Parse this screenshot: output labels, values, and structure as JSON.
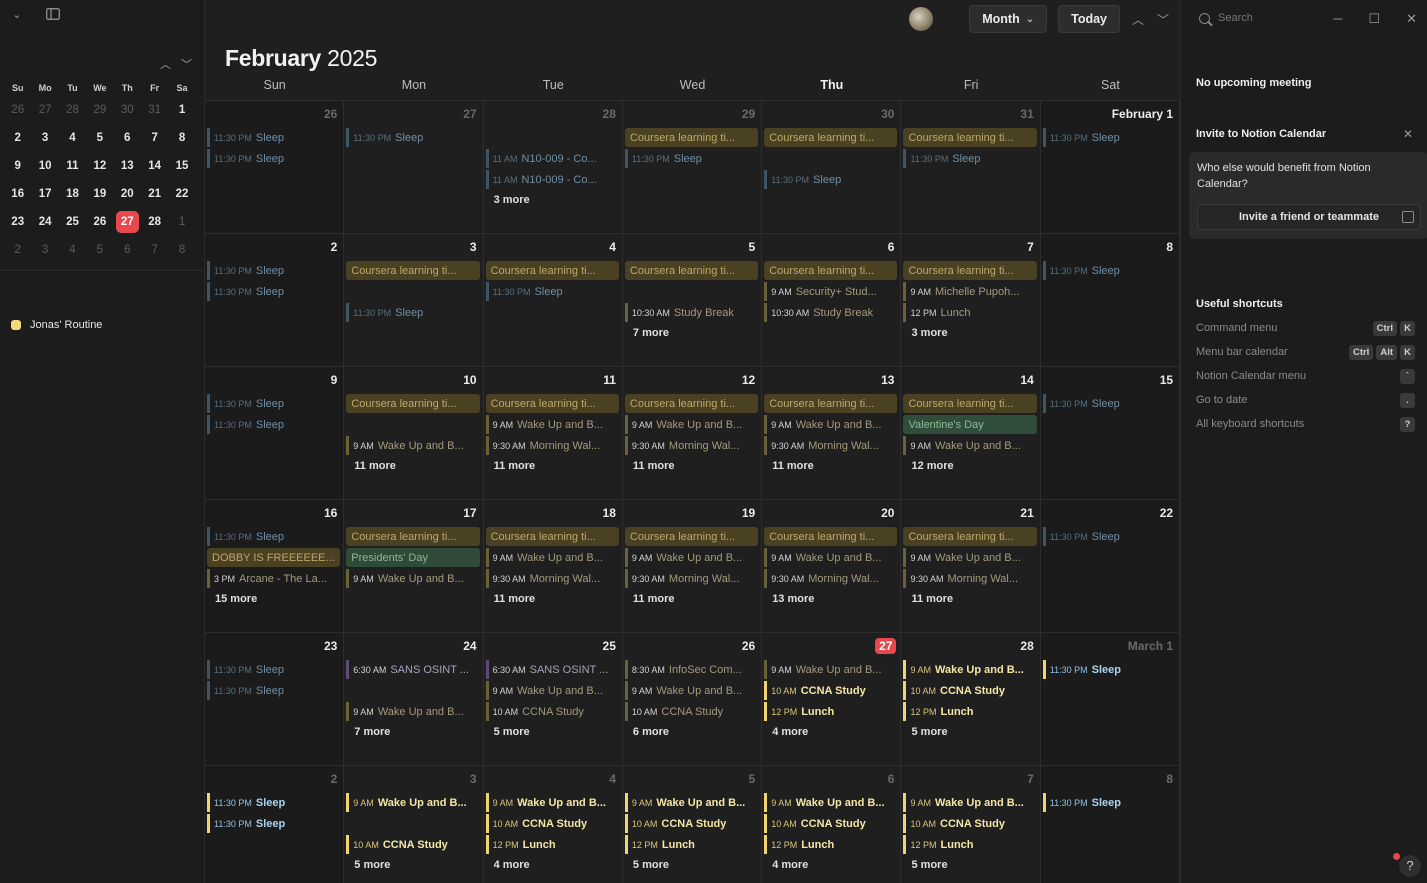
{
  "sidebar": {
    "mini_days_header": [
      "Su",
      "Mo",
      "Tu",
      "We",
      "Th",
      "Fr",
      "Sa"
    ],
    "mini_weeks": [
      [
        {
          "d": "26",
          "dim": true
        },
        {
          "d": "27",
          "dim": true
        },
        {
          "d": "28",
          "dim": true
        },
        {
          "d": "29",
          "dim": true
        },
        {
          "d": "30",
          "dim": true
        },
        {
          "d": "31",
          "dim": true
        },
        {
          "d": "1"
        }
      ],
      [
        {
          "d": "2"
        },
        {
          "d": "3"
        },
        {
          "d": "4"
        },
        {
          "d": "5"
        },
        {
          "d": "6"
        },
        {
          "d": "7"
        },
        {
          "d": "8"
        }
      ],
      [
        {
          "d": "9"
        },
        {
          "d": "10"
        },
        {
          "d": "11"
        },
        {
          "d": "12"
        },
        {
          "d": "13"
        },
        {
          "d": "14"
        },
        {
          "d": "15"
        }
      ],
      [
        {
          "d": "16"
        },
        {
          "d": "17"
        },
        {
          "d": "18"
        },
        {
          "d": "19"
        },
        {
          "d": "20"
        },
        {
          "d": "21"
        },
        {
          "d": "22"
        }
      ],
      [
        {
          "d": "23"
        },
        {
          "d": "24"
        },
        {
          "d": "25"
        },
        {
          "d": "26"
        },
        {
          "d": "27",
          "today": true
        },
        {
          "d": "28"
        },
        {
          "d": "1",
          "dim": true
        }
      ],
      [
        {
          "d": "2",
          "dim": true
        },
        {
          "d": "3",
          "dim": true
        },
        {
          "d": "4",
          "dim": true
        },
        {
          "d": "5",
          "dim": true
        },
        {
          "d": "6",
          "dim": true
        },
        {
          "d": "7",
          "dim": true
        },
        {
          "d": "8",
          "dim": true
        }
      ]
    ],
    "calendar_name": "Jonas' Routine",
    "calendar_color": "#f3d97a"
  },
  "toolbar": {
    "view_label": "Month",
    "today_label": "Today"
  },
  "header": {
    "month": "February",
    "year": "2025",
    "weekdays": [
      "Sun",
      "Mon",
      "Tue",
      "Wed",
      "Thu",
      "Fri",
      "Sat"
    ],
    "current_weekday_index": 4
  },
  "weeks": [
    [
      {
        "num": "26",
        "dim": true,
        "events": [
          {
            "s": "line past-blue",
            "t": "11:30 PM",
            "n": "Sleep"
          },
          {
            "s": "line past-blue",
            "t": "11:30 PM",
            "n": "Sleep"
          }
        ]
      },
      {
        "num": "27",
        "dim": true,
        "events": [
          {
            "s": "line past-blue",
            "t": "11:30 PM",
            "n": "Sleep"
          }
        ]
      },
      {
        "num": "28",
        "dim": true,
        "events": [
          {
            "s": "blank"
          },
          {
            "s": "line past-blue",
            "t": "11 AM",
            "n": "N10-009 - Co..."
          },
          {
            "s": "line past-blue",
            "t": "11 AM",
            "n": "N10-009 - Co..."
          }
        ],
        "more": "3 more"
      },
      {
        "num": "29",
        "dim": true,
        "events": [
          {
            "s": "block-yel",
            "n": "Coursera learning ti..."
          },
          {
            "s": "line past-blue",
            "t": "11:30 PM",
            "n": "Sleep"
          }
        ]
      },
      {
        "num": "30",
        "dim": true,
        "events": [
          {
            "s": "block-yel",
            "n": "Coursera learning ti..."
          },
          {
            "s": "blank"
          },
          {
            "s": "line past-blue",
            "t": "11:30 PM",
            "n": "Sleep"
          }
        ]
      },
      {
        "num": "31",
        "dim": true,
        "events": [
          {
            "s": "block-yel",
            "n": "Coursera learning ti..."
          },
          {
            "s": "line past-blue",
            "t": "11:30 PM",
            "n": "Sleep"
          }
        ]
      },
      {
        "num": "February 1",
        "mlabel": true,
        "events": [
          {
            "s": "line past-blue",
            "t": "11:30 PM",
            "n": "Sleep"
          }
        ]
      }
    ],
    [
      {
        "num": "2",
        "events": [
          {
            "s": "line past-blue",
            "t": "11:30 PM",
            "n": "Sleep"
          },
          {
            "s": "line past-blue",
            "t": "11:30 PM",
            "n": "Sleep"
          }
        ]
      },
      {
        "num": "3",
        "events": [
          {
            "s": "block-yel",
            "n": "Coursera learning ti..."
          },
          {
            "s": "blank"
          },
          {
            "s": "line past-blue",
            "t": "11:30 PM",
            "n": "Sleep"
          }
        ]
      },
      {
        "num": "4",
        "events": [
          {
            "s": "block-yel",
            "n": "Coursera learning ti..."
          },
          {
            "s": "line past-blue",
            "t": "11:30 PM",
            "n": "Sleep"
          }
        ]
      },
      {
        "num": "5",
        "events": [
          {
            "s": "block-yel",
            "n": "Coursera learning ti..."
          },
          {
            "s": "blank"
          },
          {
            "s": "line past-yel",
            "t": "10:30 AM",
            "n": "Study Break"
          }
        ],
        "more": "7 more"
      },
      {
        "num": "6",
        "events": [
          {
            "s": "block-yel",
            "n": "Coursera learning ti..."
          },
          {
            "s": "line past-yel",
            "t": "9 AM",
            "n": "Security+ Stud..."
          },
          {
            "s": "line past-yel",
            "t": "10:30 AM",
            "n": "Study Break"
          }
        ]
      },
      {
        "num": "7",
        "events": [
          {
            "s": "block-yel",
            "n": "Coursera learning ti..."
          },
          {
            "s": "line past-yel",
            "t": "9 AM",
            "n": "Michelle Pupoh..."
          },
          {
            "s": "line past-yel",
            "t": "12 PM",
            "n": "Lunch"
          }
        ],
        "more": "3 more"
      },
      {
        "num": "8",
        "events": [
          {
            "s": "line past-blue",
            "t": "11:30 PM",
            "n": "Sleep"
          }
        ]
      }
    ],
    [
      {
        "num": "9",
        "events": [
          {
            "s": "line past-blue",
            "t": "11:30 PM",
            "n": "Sleep"
          },
          {
            "s": "line past-blue",
            "t": "11:30 PM",
            "n": "Sleep"
          }
        ]
      },
      {
        "num": "10",
        "events": [
          {
            "s": "block-yel",
            "n": "Coursera learning ti..."
          },
          {
            "s": "blank"
          },
          {
            "s": "line past-yel",
            "t": "9 AM",
            "n": "Wake Up and B..."
          }
        ],
        "more": "11 more"
      },
      {
        "num": "11",
        "events": [
          {
            "s": "block-yel",
            "n": "Coursera learning ti..."
          },
          {
            "s": "line past-yel",
            "t": "9 AM",
            "n": "Wake Up and B..."
          },
          {
            "s": "line past-yel",
            "t": "9:30 AM",
            "n": "Morning Wal..."
          }
        ],
        "more": "11 more"
      },
      {
        "num": "12",
        "events": [
          {
            "s": "block-yel",
            "n": "Coursera learning ti..."
          },
          {
            "s": "line past-yel",
            "t": "9 AM",
            "n": "Wake Up and B..."
          },
          {
            "s": "line past-yel",
            "t": "9:30 AM",
            "n": "Morning Wal..."
          }
        ],
        "more": "11 more"
      },
      {
        "num": "13",
        "events": [
          {
            "s": "block-yel",
            "n": "Coursera learning ti..."
          },
          {
            "s": "line past-yel",
            "t": "9 AM",
            "n": "Wake Up and B..."
          },
          {
            "s": "line past-yel",
            "t": "9:30 AM",
            "n": "Morning Wal..."
          }
        ],
        "more": "11 more"
      },
      {
        "num": "14",
        "events": [
          {
            "s": "block-yel",
            "n": "Coursera learning ti..."
          },
          {
            "s": "block-green",
            "n": "Valentine's Day"
          },
          {
            "s": "line past-yel",
            "t": "9 AM",
            "n": "Wake Up and B..."
          }
        ],
        "more": "12 more"
      },
      {
        "num": "15",
        "events": [
          {
            "s": "line past-blue",
            "t": "11:30 PM",
            "n": "Sleep"
          }
        ]
      }
    ],
    [
      {
        "num": "16",
        "events": [
          {
            "s": "line past-blue",
            "t": "11:30 PM",
            "n": "Sleep"
          },
          {
            "s": "block-yel",
            "n": "DOBBY IS FREEEEEE..."
          },
          {
            "s": "line past-yel",
            "t": "3 PM",
            "n": "Arcane - The La..."
          }
        ],
        "more": "15 more"
      },
      {
        "num": "17",
        "events": [
          {
            "s": "block-yel",
            "n": "Coursera learning ti..."
          },
          {
            "s": "block-grn-dark",
            "n": "Presidents' Day"
          },
          {
            "s": "line past-yel",
            "t": "9 AM",
            "n": "Wake Up and B..."
          }
        ]
      },
      {
        "num": "18",
        "events": [
          {
            "s": "block-yel",
            "n": "Coursera learning ti..."
          },
          {
            "s": "line past-yel",
            "t": "9 AM",
            "n": "Wake Up and B..."
          },
          {
            "s": "line past-yel",
            "t": "9:30 AM",
            "n": "Morning Wal..."
          }
        ],
        "more": "11 more"
      },
      {
        "num": "19",
        "events": [
          {
            "s": "block-yel",
            "n": "Coursera learning ti..."
          },
          {
            "s": "line past-yel",
            "t": "9 AM",
            "n": "Wake Up and B..."
          },
          {
            "s": "line past-yel",
            "t": "9:30 AM",
            "n": "Morning Wal..."
          }
        ],
        "more": "11 more"
      },
      {
        "num": "20",
        "events": [
          {
            "s": "block-yel",
            "n": "Coursera learning ti..."
          },
          {
            "s": "line past-yel",
            "t": "9 AM",
            "n": "Wake Up and B..."
          },
          {
            "s": "line past-yel",
            "t": "9:30 AM",
            "n": "Morning Wal..."
          }
        ],
        "more": "13 more"
      },
      {
        "num": "21",
        "events": [
          {
            "s": "block-yel",
            "n": "Coursera learning ti..."
          },
          {
            "s": "line past-yel",
            "t": "9 AM",
            "n": "Wake Up and B..."
          },
          {
            "s": "line past-yel",
            "t": "9:30 AM",
            "n": "Morning Wal..."
          }
        ],
        "more": "11 more"
      },
      {
        "num": "22",
        "events": [
          {
            "s": "line past-blue",
            "t": "11:30 PM",
            "n": "Sleep"
          }
        ]
      }
    ],
    [
      {
        "num": "23",
        "events": [
          {
            "s": "line past-blue",
            "t": "11:30 PM",
            "n": "Sleep"
          },
          {
            "s": "line past-blue",
            "t": "11:30 PM",
            "n": "Sleep"
          }
        ]
      },
      {
        "num": "24",
        "events": [
          {
            "s": "line past-purple",
            "t": "6:30 AM",
            "n": "SANS OSINT ..."
          },
          {
            "s": "blank"
          },
          {
            "s": "line past-yel",
            "t": "9 AM",
            "n": "Wake Up and B..."
          }
        ],
        "more": "7 more"
      },
      {
        "num": "25",
        "events": [
          {
            "s": "line past-purple",
            "t": "6:30 AM",
            "n": "SANS OSINT ..."
          },
          {
            "s": "line past-yel",
            "t": "9 AM",
            "n": "Wake Up and B..."
          },
          {
            "s": "line past-yel",
            "t": "10 AM",
            "n": "CCNA Study"
          }
        ],
        "more": "5 more"
      },
      {
        "num": "26",
        "events": [
          {
            "s": "line past-yel",
            "t": "8:30 AM",
            "n": "InfoSec Com..."
          },
          {
            "s": "line past-yel",
            "t": "9 AM",
            "n": "Wake Up and B..."
          },
          {
            "s": "line past-yel",
            "t": "10 AM",
            "n": "CCNA Study"
          }
        ],
        "more": "6 more"
      },
      {
        "num": "27",
        "today": true,
        "events": [
          {
            "s": "line past-yel",
            "t": "9 AM",
            "n": "Wake Up and B..."
          },
          {
            "s": "line hl-yel",
            "t": "10 AM",
            "n": "CCNA Study"
          },
          {
            "s": "line hl-yel",
            "t": "12 PM",
            "n": "Lunch"
          }
        ],
        "more": "4 more"
      },
      {
        "num": "28",
        "events": [
          {
            "s": "line hl-yel",
            "t": "9 AM",
            "n": "Wake Up and B..."
          },
          {
            "s": "line hl-yel",
            "t": "10 AM",
            "n": "CCNA Study"
          },
          {
            "s": "line hl-yel",
            "t": "12 PM",
            "n": "Lunch"
          }
        ],
        "more": "5 more"
      },
      {
        "num": "March 1",
        "mlabel": true,
        "dim": true,
        "events": [
          {
            "s": "line hl-blue",
            "t": "11:30 PM",
            "n": "Sleep"
          }
        ]
      }
    ],
    [
      {
        "num": "2",
        "dim": true,
        "events": [
          {
            "s": "line hl-blue",
            "t": "11:30 PM",
            "n": "Sleep"
          },
          {
            "s": "line hl-blue",
            "t": "11:30 PM",
            "n": "Sleep"
          }
        ]
      },
      {
        "num": "3",
        "dim": true,
        "events": [
          {
            "s": "line hl-yel",
            "t": "9 AM",
            "n": "Wake Up and B..."
          },
          {
            "s": "blank"
          },
          {
            "s": "line hl-yel",
            "t": "10 AM",
            "n": "CCNA Study"
          }
        ],
        "more": "5 more"
      },
      {
        "num": "4",
        "dim": true,
        "events": [
          {
            "s": "line hl-yel",
            "t": "9 AM",
            "n": "Wake Up and B..."
          },
          {
            "s": "line hl-yel",
            "t": "10 AM",
            "n": "CCNA Study"
          },
          {
            "s": "line hl-yel",
            "t": "12 PM",
            "n": "Lunch"
          }
        ],
        "more": "4 more"
      },
      {
        "num": "5",
        "dim": true,
        "events": [
          {
            "s": "line hl-yel",
            "t": "9 AM",
            "n": "Wake Up and B..."
          },
          {
            "s": "line hl-yel",
            "t": "10 AM",
            "n": "CCNA Study"
          },
          {
            "s": "line hl-yel",
            "t": "12 PM",
            "n": "Lunch"
          }
        ],
        "more": "5 more"
      },
      {
        "num": "6",
        "dim": true,
        "events": [
          {
            "s": "line hl-yel",
            "t": "9 AM",
            "n": "Wake Up and B..."
          },
          {
            "s": "line hl-yel",
            "t": "10 AM",
            "n": "CCNA Study"
          },
          {
            "s": "line hl-yel",
            "t": "12 PM",
            "n": "Lunch"
          }
        ],
        "more": "4 more"
      },
      {
        "num": "7",
        "dim": true,
        "events": [
          {
            "s": "line hl-yel",
            "t": "9 AM",
            "n": "Wake Up and B..."
          },
          {
            "s": "line hl-yel",
            "t": "10 AM",
            "n": "CCNA Study"
          },
          {
            "s": "line hl-yel",
            "t": "12 PM",
            "n": "Lunch"
          }
        ],
        "more": "5 more"
      },
      {
        "num": "8",
        "dim": true,
        "events": [
          {
            "s": "line hl-blue",
            "t": "11:30 PM",
            "n": "Sleep"
          }
        ]
      }
    ]
  ],
  "right_panel": {
    "search_placeholder": "Search",
    "no_meeting": "No upcoming meeting",
    "invite_title": "Invite to Notion Calendar",
    "invite_question": "Who else would benefit from Notion Calendar?",
    "invite_button": "Invite a friend or teammate",
    "shortcuts_title": "Useful shortcuts",
    "shortcuts": [
      {
        "label": "Command menu",
        "keys": [
          "Ctrl",
          "K"
        ]
      },
      {
        "label": "Menu bar calendar",
        "keys": [
          "Ctrl",
          "Alt",
          "K"
        ]
      },
      {
        "label": "Notion Calendar menu",
        "keys": [
          "`"
        ]
      },
      {
        "label": "Go to date",
        "keys": [
          "."
        ]
      },
      {
        "label": "All keyboard shortcuts",
        "keys": [
          "?"
        ]
      }
    ],
    "help_label": "?"
  },
  "colors": {
    "accent_today": "#e5484d",
    "event_yellow": "#f1d66d",
    "routine_swatch": "#f3d97a"
  }
}
